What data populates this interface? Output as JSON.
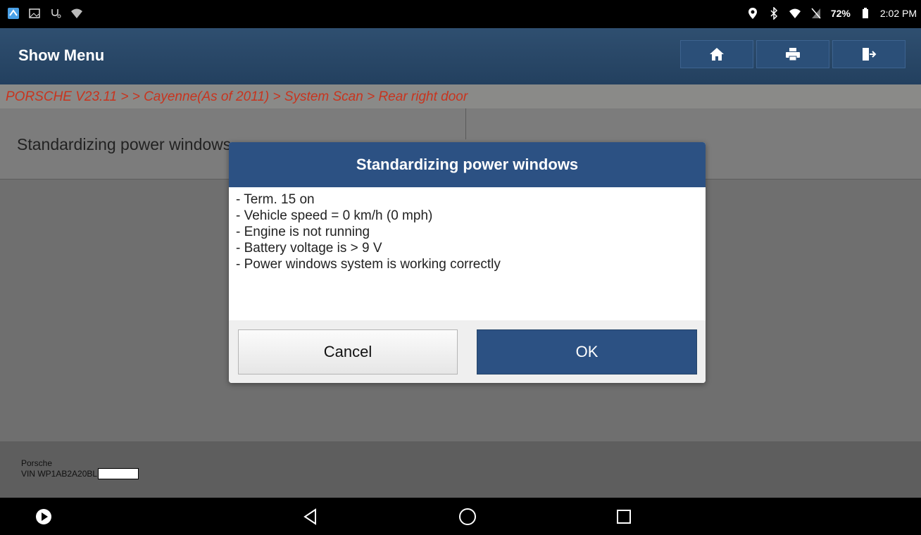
{
  "status_bar": {
    "left_icons": [
      "launcher-icon",
      "image-icon",
      "stethoscope-icon",
      "wifi-question-icon"
    ],
    "right_icons": [
      "location-icon",
      "bluetooth-icon",
      "wifi-icon",
      "no-sim-icon",
      "battery-icon"
    ],
    "battery_pct": "72%",
    "time": "2:02 PM"
  },
  "header": {
    "title": "Show Menu",
    "buttons": [
      "home-icon",
      "print-icon",
      "exit-icon"
    ]
  },
  "breadcrumb": "PORSCHE V23.11 >  > Cayenne(As of 2011) > System Scan > Rear right door",
  "list": {
    "item_label": "Standardizing power windows"
  },
  "dialog": {
    "title": "Standardizing power windows",
    "lines": [
      "- Term. 15 on",
      "- Vehicle speed = 0 km/h (0 mph)",
      "- Engine is not running",
      "- Battery voltage is > 9 V",
      "- Power windows system is working correctly"
    ],
    "cancel_label": "Cancel",
    "ok_label": "OK"
  },
  "footer": {
    "make": "Porsche",
    "vin_prefix": "VIN WP1AB2A20BL"
  },
  "colors": {
    "header_blue": "#2c5183",
    "breadcrumb_red": "#c8341e"
  }
}
